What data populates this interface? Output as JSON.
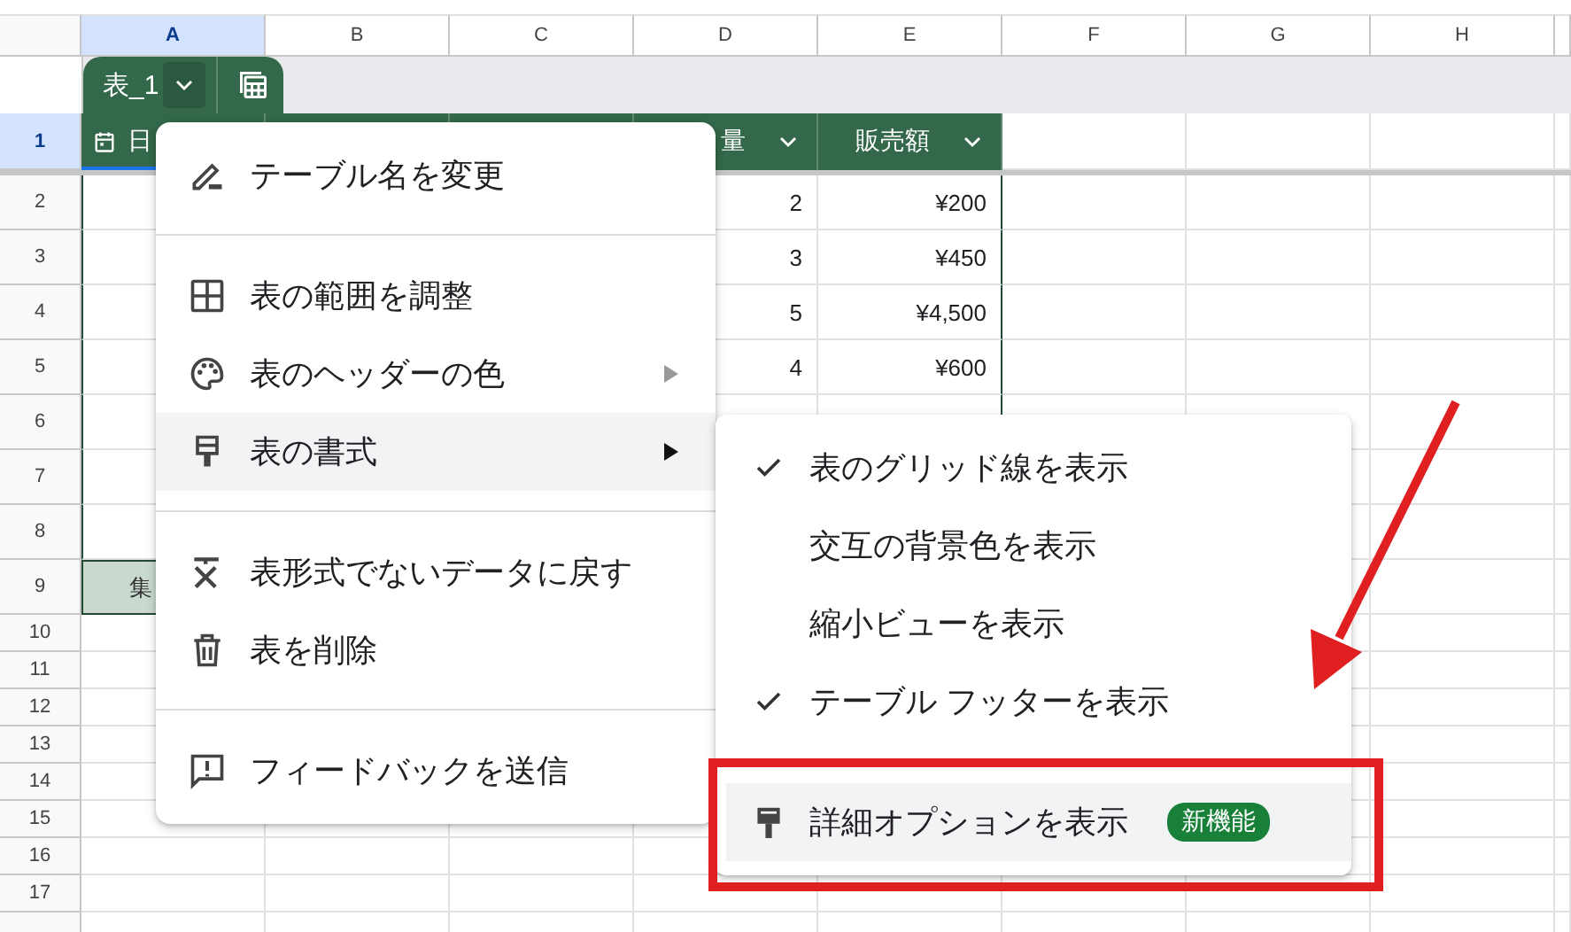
{
  "column_headers": [
    {
      "label": "A",
      "selected": true
    },
    {
      "label": "B",
      "selected": false
    },
    {
      "label": "C",
      "selected": false
    },
    {
      "label": "D",
      "selected": false
    },
    {
      "label": "E",
      "selected": false
    },
    {
      "label": "F",
      "selected": false
    },
    {
      "label": "G",
      "selected": false
    },
    {
      "label": "H",
      "selected": false
    }
  ],
  "row_headers": [
    {
      "label": "1",
      "selected": true
    },
    {
      "label": "2",
      "selected": false
    },
    {
      "label": "3",
      "selected": false
    },
    {
      "label": "4",
      "selected": false
    },
    {
      "label": "5",
      "selected": false
    },
    {
      "label": "6",
      "selected": false
    },
    {
      "label": "7",
      "selected": false
    },
    {
      "label": "8",
      "selected": false
    },
    {
      "label": "9",
      "selected": false
    },
    {
      "label": "10",
      "selected": false
    },
    {
      "label": "11",
      "selected": false
    },
    {
      "label": "12",
      "selected": false
    },
    {
      "label": "13",
      "selected": false
    },
    {
      "label": "14",
      "selected": false
    },
    {
      "label": "15",
      "selected": false
    },
    {
      "label": "16",
      "selected": false
    },
    {
      "label": "17",
      "selected": false
    }
  ],
  "table": {
    "name": "表_1",
    "header": {
      "column_1": "日",
      "column_4": "量",
      "column_5": "販売額"
    },
    "rows": [
      {
        "column_4": "2",
        "column_5": "¥200"
      },
      {
        "column_4": "3",
        "column_5": "¥450"
      },
      {
        "column_4": "5",
        "column_5": "¥4,500"
      },
      {
        "column_4": "4",
        "column_5": "¥600"
      }
    ],
    "footer": {
      "column_1": "集"
    }
  },
  "menu": {
    "items": [
      {
        "kind": "item",
        "label": "テーブル名を変更",
        "has_submenu": false,
        "expanded": false
      },
      {
        "kind": "divider"
      },
      {
        "kind": "item",
        "label": "表の範囲を調整",
        "has_submenu": false,
        "expanded": false
      },
      {
        "kind": "item",
        "label": "表のヘッダーの色",
        "has_submenu": true,
        "expanded": false
      },
      {
        "kind": "item",
        "label": "表の書式",
        "has_submenu": true,
        "expanded": true
      },
      {
        "kind": "divider"
      },
      {
        "kind": "item",
        "label": "表形式でないデータに戻す",
        "has_submenu": false,
        "expanded": false
      },
      {
        "kind": "item",
        "label": "表を削除",
        "has_submenu": false,
        "expanded": false
      },
      {
        "kind": "divider"
      },
      {
        "kind": "item",
        "label": "フィードバックを送信",
        "has_submenu": false,
        "expanded": false
      }
    ]
  },
  "submenu": {
    "items": [
      {
        "kind": "toggle",
        "label": "表のグリッド線を表示",
        "checked": true
      },
      {
        "kind": "toggle",
        "label": "交互の背景色を表示",
        "checked": false
      },
      {
        "kind": "toggle",
        "label": "縮小ビューを表示",
        "checked": false
      },
      {
        "kind": "toggle",
        "label": "テーブル フッターを表示",
        "checked": true
      },
      {
        "kind": "divider"
      },
      {
        "kind": "option",
        "label": "詳細オプションを表示",
        "badge": "新機能",
        "highlighted": true
      }
    ]
  },
  "annotation": {
    "arrow": true,
    "highlight_frame": true
  }
}
